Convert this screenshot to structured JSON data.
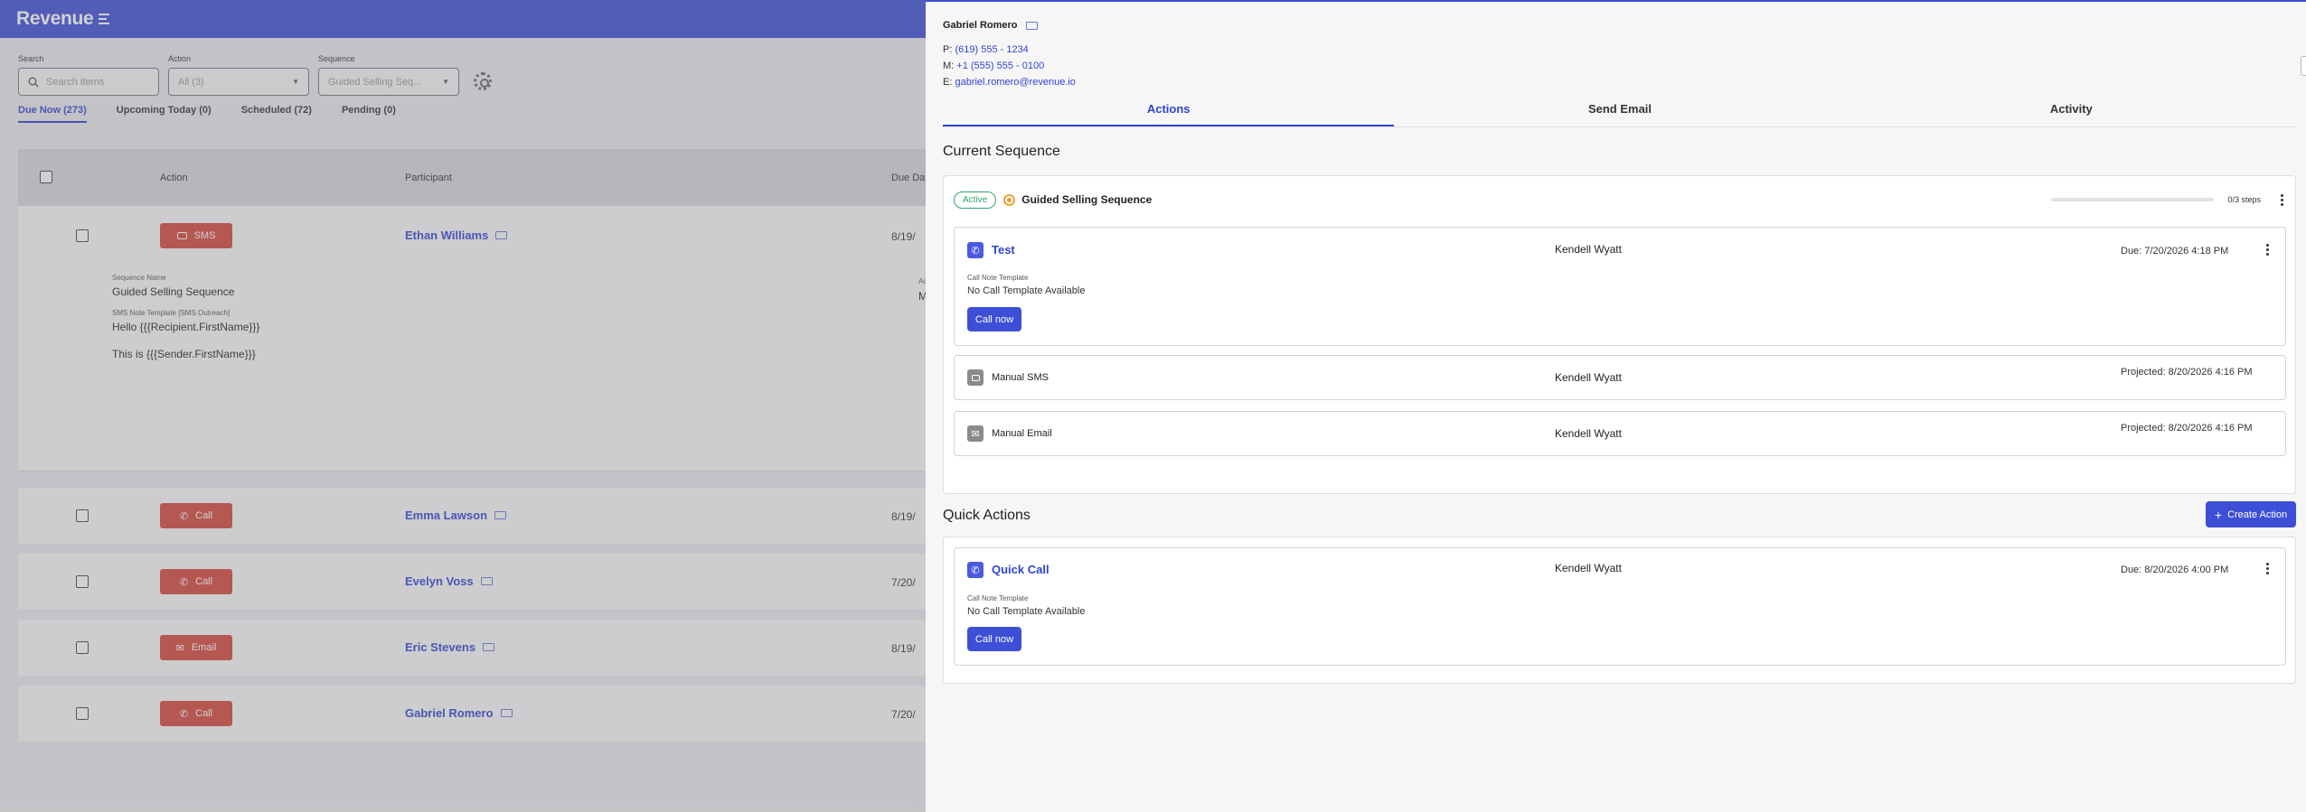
{
  "app": {
    "brand": "Revenue"
  },
  "filters": {
    "search_label": "Search",
    "search_placeholder": "Search items",
    "action_label": "Action",
    "action_value": "All (3)",
    "sequence_label": "Sequence",
    "sequence_value": "Guided Selling Seq..."
  },
  "list_tabs": [
    {
      "label": "Due Now (273)",
      "active": true
    },
    {
      "label": "Upcoming Today (0)",
      "active": false
    },
    {
      "label": "Scheduled (72)",
      "active": false
    },
    {
      "label": "Pending (0)",
      "active": false
    }
  ],
  "table": {
    "columns": {
      "action": "Action",
      "participant": "Participant",
      "due": "Due Dat"
    },
    "rows": [
      {
        "action": "SMS",
        "participant": "Ethan Williams",
        "due": "8/19/"
      },
      {
        "action": "Call",
        "participant": "Emma Lawson",
        "due": "8/19/"
      },
      {
        "action": "Call",
        "participant": "Evelyn Voss",
        "due": "7/20/"
      },
      {
        "action": "Email",
        "participant": "Eric Stevens",
        "due": "8/19/"
      },
      {
        "action": "Call",
        "participant": "Gabriel Romero",
        "due": "7/20/"
      }
    ],
    "expanded": {
      "seq_label": "Sequence Name",
      "seq_value": "Guided Selling Sequence",
      "tpl_label": "SMS Note Template [SMS Outreach]",
      "tpl_line1": "Hello {{{Recipient.FirstName}}}",
      "tpl_line2": "This is {{{Sender.FirstName}}}",
      "side_label": "Ac",
      "side_value": "M"
    }
  },
  "panel": {
    "contact": {
      "name": "Gabriel Romero",
      "phone_prefix": "P:",
      "phone": "(619) 555 - 1234",
      "mobile_prefix": "M:",
      "mobile": "+1 (555) 555 - 0100",
      "email_prefix": "E:",
      "email": "gabriel.romero@revenue.io"
    },
    "tabs": [
      "Actions",
      "Send Email",
      "Activity"
    ],
    "current_sequence": {
      "title": "Current Sequence",
      "status": "Active",
      "name": "Guided Selling Sequence",
      "progress_text": "0/3 steps",
      "progress_fraction": 0,
      "steps": [
        {
          "title": "Test",
          "assignee": "Kendell Wyatt",
          "due": "Due: 7/20/2026 4:18 PM",
          "tpl_label": "Call Note Template",
          "tpl_value": "No Call Template Available",
          "button": "Call now"
        },
        {
          "title": "Manual SMS",
          "assignee": "Kendell Wyatt",
          "due": "Projected: 8/20/2026 4:16 PM"
        },
        {
          "title": "Manual Email",
          "assignee": "Kendell Wyatt",
          "due": "Projected: 8/20/2026 4:16 PM"
        }
      ]
    },
    "quick_actions": {
      "title": "Quick Actions",
      "create_label": "Create Action",
      "item": {
        "title": "Quick Call",
        "assignee": "Kendell Wyatt",
        "due": "Due: 8/20/2026 4:00 PM",
        "tpl_label": "Call Note Template",
        "tpl_value": "No Call Template Available",
        "button": "Call now"
      }
    }
  },
  "colors": {
    "brand": "#3d4fd6",
    "action_red": "#d8473b",
    "active_green": "#2fa56a"
  }
}
